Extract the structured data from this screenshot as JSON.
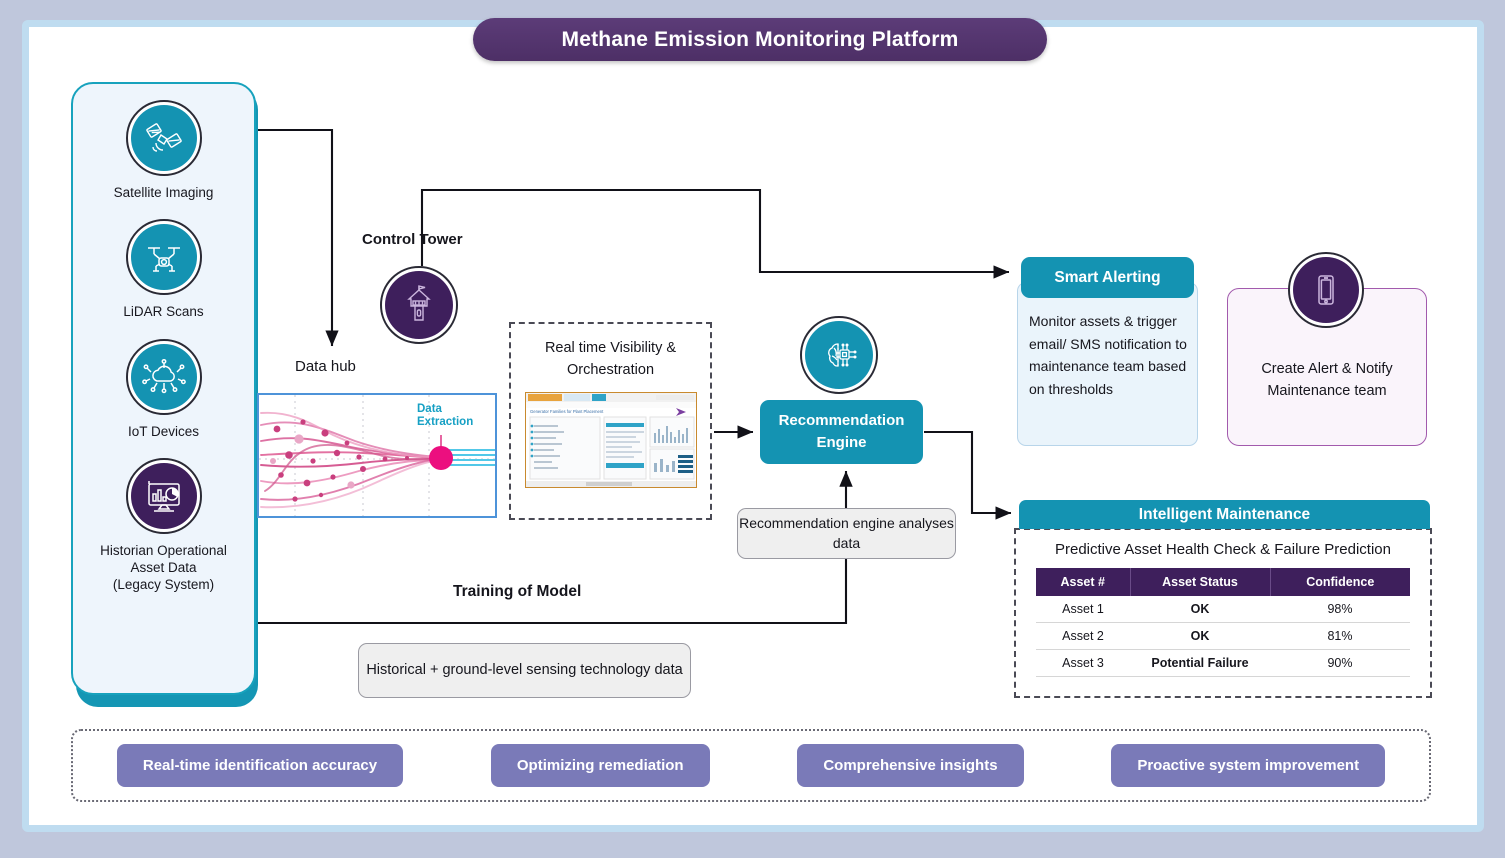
{
  "title": "Methane Emission Monitoring Platform",
  "sources": {
    "items": [
      {
        "label": "Satellite Imaging",
        "icon": "satellite-icon",
        "tone": "teal"
      },
      {
        "label": "LiDAR Scans",
        "icon": "drone-icon",
        "tone": "teal"
      },
      {
        "label": "IoT Devices",
        "icon": "iot-cloud-icon",
        "tone": "teal"
      },
      {
        "label": "Historian Operational Asset Data (Legacy System)",
        "icon": "dashboard-monitor-icon",
        "tone": "purple"
      }
    ]
  },
  "control_tower": {
    "label": "Control Tower",
    "icon": "control-tower-icon"
  },
  "data_hub": {
    "label": "Data hub",
    "annotation": "Data Extraction",
    "icon": "network-flow-graphic"
  },
  "real_time": {
    "title": "Real time Visibility & Orchestration",
    "thumbnail": "dashboard-screenshot"
  },
  "recommendation": {
    "icon": "ai-brain-chip-icon",
    "box_label": "Recommendation Engine",
    "note": "Recommendation engine analyses data"
  },
  "training": {
    "label": "Training of Model",
    "data_box": "Historical + ground-level sensing technology data"
  },
  "smart_alerting": {
    "header": "Smart Alerting",
    "body": "Monitor assets & trigger email/ SMS notification to maintenance team based on thresholds"
  },
  "create_alert": {
    "text": "Create Alert & Notify Maintenance team",
    "icon": "mobile-phone-icon"
  },
  "intelligent_maintenance": {
    "header": "Intelligent Maintenance",
    "subtitle": "Predictive Asset Health Check & Failure Prediction",
    "columns": [
      "Asset #",
      "Asset Status",
      "Confidence"
    ],
    "rows": [
      {
        "asset": "Asset 1",
        "status": "OK",
        "status_type": "ok",
        "confidence": "98%"
      },
      {
        "asset": "Asset 2",
        "status": "OK",
        "status_type": "ok",
        "confidence": "81%"
      },
      {
        "asset": "Asset 3",
        "status": "Potential Failure",
        "status_type": "fail",
        "confidence": "90%"
      }
    ]
  },
  "benefits": [
    "Real-time identification accuracy",
    "Optimizing remediation",
    "Comprehensive insights",
    "Proactive system improvement"
  ],
  "colors": {
    "teal": "#1493b2",
    "purple": "#3e1f5c",
    "title_purple": "#4d2f66",
    "benefit_purple": "#7a7ab8",
    "status_ok": "#9cbb5a",
    "status_fail": "#d40511",
    "page_bg": "#bfc7dc",
    "frame_blue": "#bfdcf0"
  }
}
